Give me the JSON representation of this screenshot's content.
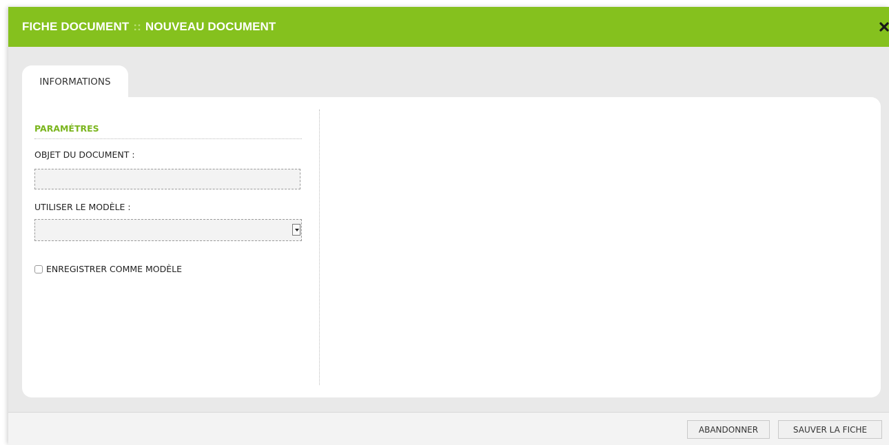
{
  "dialog": {
    "title_part1": "FICHE DOCUMENT",
    "title_separator": "::",
    "title_part2": "NOUVEAU DOCUMENT",
    "close_icon": "close-icon"
  },
  "tabs": [
    {
      "label": "INFORMATIONS",
      "active": true
    }
  ],
  "form": {
    "section_heading": "PARAMÉTRES",
    "object_label": "OBJET DU DOCUMENT :",
    "object_value": "",
    "template_label": "UTILISER LE MODÈLE :",
    "template_value": "",
    "save_as_template_label": "ENREGISTRER COMME MODÈLE",
    "save_as_template_checked": false
  },
  "footer": {
    "cancel_label": "ABANDONNER",
    "save_label": "SAUVER LA FICHE"
  },
  "colors": {
    "titlebar": "#85c11e",
    "heading": "#7ab51d"
  }
}
